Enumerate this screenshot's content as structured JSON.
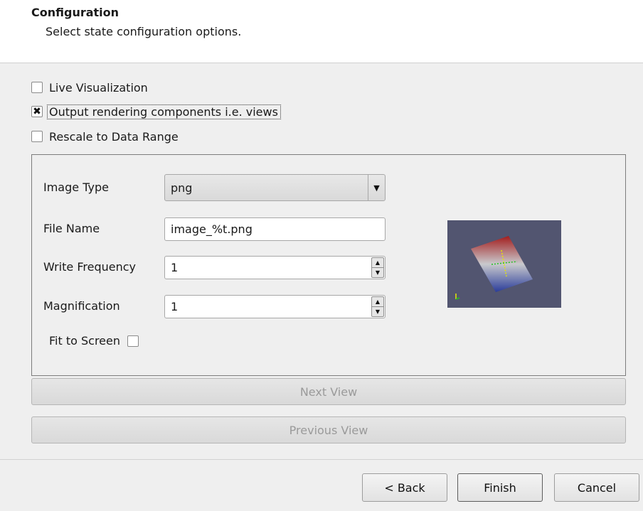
{
  "header": {
    "title": "Configuration",
    "subtitle": "Select state configuration options."
  },
  "options": {
    "live_visualization": {
      "label": "Live Visualization",
      "checked": false
    },
    "output_rendering": {
      "label": "Output rendering components i.e. views",
      "checked": true
    },
    "rescale": {
      "label": "Rescale to Data Range",
      "checked": false
    }
  },
  "form": {
    "image_type": {
      "label": "Image Type",
      "value": "png"
    },
    "file_name": {
      "label": "File Name",
      "value": "image_%t.png"
    },
    "write_frequency": {
      "label": "Write Frequency",
      "value": "1"
    },
    "magnification": {
      "label": "Magnification",
      "value": "1"
    },
    "fit_to_screen": {
      "label": "Fit to Screen",
      "checked": false
    }
  },
  "view_buttons": {
    "next": "Next View",
    "previous": "Previous View"
  },
  "footer": {
    "back": "< Back",
    "finish": "Finish",
    "cancel": "Cancel"
  },
  "icons": {
    "checkmark": "✖",
    "dropdown": "▼",
    "spin_up": "▲",
    "spin_down": "▼"
  },
  "colors": {
    "preview_background": "#525570"
  }
}
